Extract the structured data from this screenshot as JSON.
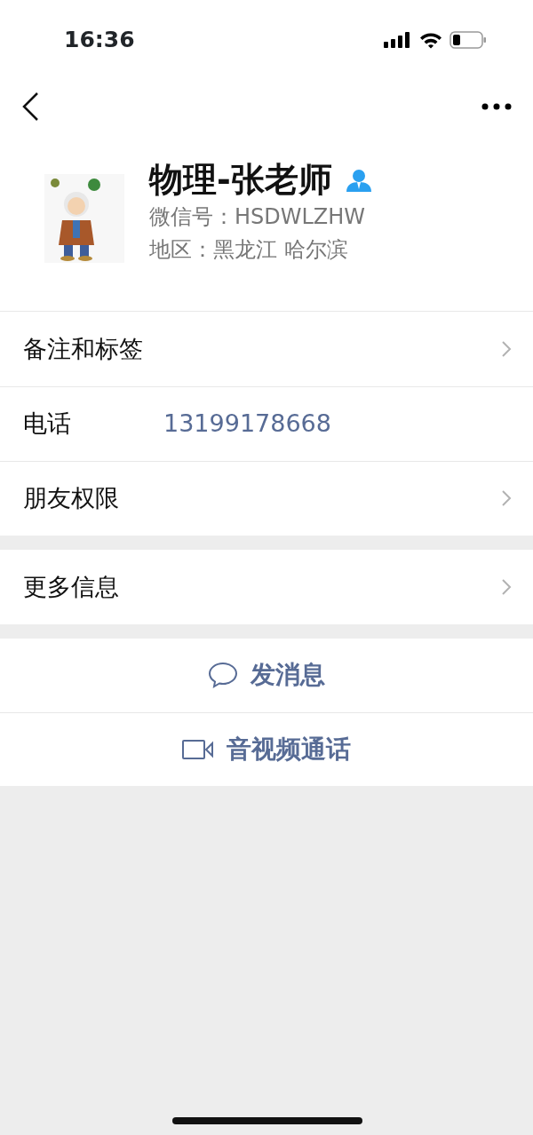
{
  "status_bar": {
    "time": "16:36"
  },
  "profile": {
    "name": "物理-张老师",
    "wechat_id": "微信号：HSDWLZHW",
    "region": "地区：黑龙江 哈尔滨"
  },
  "groups": [
    {
      "rows": [
        {
          "kind": "link",
          "label": "备注和标签"
        },
        {
          "kind": "value",
          "label": "电话",
          "value": "13199178668"
        },
        {
          "kind": "link",
          "label": "朋友权限"
        }
      ]
    },
    {
      "rows": [
        {
          "kind": "link",
          "label": "更多信息"
        }
      ]
    }
  ],
  "actions": [
    {
      "kind": "message",
      "label": "发消息"
    },
    {
      "kind": "video",
      "label": "音视频通话"
    }
  ]
}
